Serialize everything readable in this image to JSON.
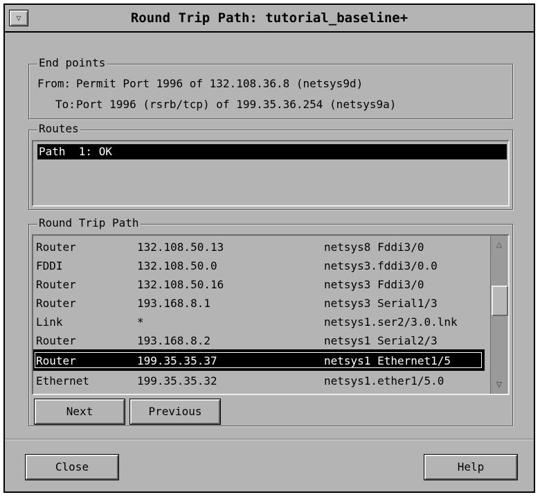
{
  "window": {
    "title": "Round Trip Path: tutorial_baseline+"
  },
  "endpoints": {
    "label": "End points",
    "from_label": "From:",
    "from_value": "Permit Port 1996 of 132.108.36.8 (netsys9d)",
    "to_label": "To:",
    "to_value": "Port 1996 (rsrb/tcp) of 199.35.36.254 (netsys9a)"
  },
  "routes": {
    "label": "Routes",
    "items": [
      "Path  1: OK"
    ]
  },
  "round_trip": {
    "label": "Round Trip Path",
    "rows": [
      [
        "Router",
        "132.108.50.13",
        "netsys8 Fddi3/0"
      ],
      [
        "FDDI",
        "132.108.50.0",
        "netsys3.fddi3/0.0"
      ],
      [
        "Router",
        "132.108.50.16",
        "netsys3 Fddi3/0"
      ],
      [
        "Router",
        "193.168.8.1",
        "netsys3 Serial1/3"
      ],
      [
        "Link",
        "*",
        "netsys1.ser2/3.0.lnk"
      ],
      [
        "Router",
        "193.168.8.2",
        "netsys1 Serial2/3"
      ],
      [
        "Router",
        "199.35.35.37",
        "netsys1 Ethernet1/5"
      ],
      [
        "Ethernet",
        "199.35.35.32",
        "netsys1.ether1/5.0"
      ]
    ],
    "selected_index": 6,
    "next_label": "Next",
    "previous_label": "Previous"
  },
  "footer": {
    "close_label": "Close",
    "help_label": "Help"
  },
  "icons": {
    "window_menu": "chevron-down-icon",
    "scroll_up": "up-arrow-icon",
    "scroll_down": "down-arrow-icon"
  }
}
